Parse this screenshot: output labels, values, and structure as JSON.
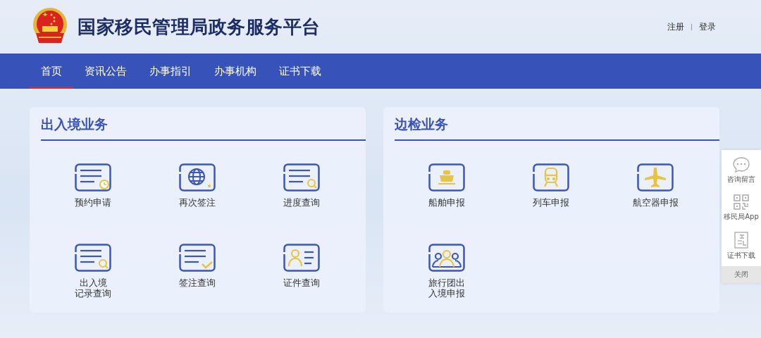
{
  "header": {
    "title": "国家移民管理局政务服务平台",
    "links": [
      "注册",
      "登录"
    ]
  },
  "nav": [
    {
      "label": "首页",
      "selected": true
    },
    {
      "label": "资讯公告",
      "selected": false
    },
    {
      "label": "办事指引",
      "selected": false
    },
    {
      "label": "办事机构",
      "selected": false
    },
    {
      "label": "证书下载",
      "selected": false
    }
  ],
  "panels": [
    {
      "title": "出入境业务",
      "services": [
        {
          "label": "预约申请",
          "kind": "doc-clock"
        },
        {
          "label": "再次签注",
          "kind": "globe"
        },
        {
          "label": "进度查询",
          "kind": "doc-search"
        },
        {
          "label": [
            "出入境",
            "记录查询"
          ],
          "kind": "doc-search"
        },
        {
          "label": "签注查询",
          "kind": "doc-check"
        },
        {
          "label": "证件查询",
          "kind": "person-card"
        }
      ]
    },
    {
      "title": "边检业务",
      "services": [
        {
          "label": "船舶申报",
          "kind": "ship"
        },
        {
          "label": "列车申报",
          "kind": "train"
        },
        {
          "label": "航空器申报",
          "kind": "plane"
        },
        {
          "label": [
            "旅行团出",
            "入境申报"
          ],
          "kind": "group"
        }
      ]
    }
  ],
  "side_tools": {
    "items": [
      {
        "label": "咨询留言",
        "kind": "chat"
      },
      {
        "label": "移民局App",
        "kind": "qr"
      },
      {
        "label": "证书下载",
        "kind": "certificate"
      }
    ],
    "close": "关闭"
  }
}
